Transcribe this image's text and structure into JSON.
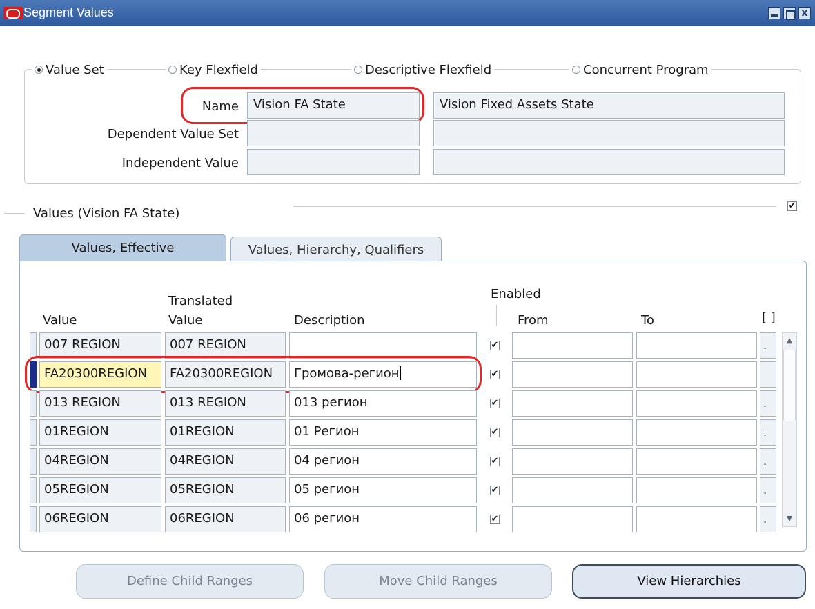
{
  "window": {
    "title": "Segment Values",
    "controls": {
      "minimize": "minimize",
      "maximize": "maximize",
      "close": "x"
    }
  },
  "query_by": {
    "options": [
      "Value Set",
      "Key Flexfield",
      "Descriptive Flexfield",
      "Concurrent Program"
    ],
    "selected": "Value Set",
    "name_label": "Name",
    "name_value": "Vision FA State",
    "name_description": "Vision Fixed Assets State",
    "dependent_label": "Dependent Value Set",
    "dependent_value": "",
    "dependent_description": "",
    "independent_label": "Independent Value",
    "independent_value": "",
    "independent_description": ""
  },
  "values_section": {
    "title": "Values (Vision FA State)",
    "checkbox_checked": true
  },
  "tabs": [
    {
      "label": "Values, Effective",
      "active": true
    },
    {
      "label": "Values, Hierarchy, Qualifiers",
      "active": false
    }
  ],
  "table": {
    "headers": {
      "value": "Value",
      "translated_line1": "Translated",
      "translated_line2": "Value",
      "description": "Description",
      "enabled": "Enabled",
      "from": "From",
      "to": "To",
      "dff": "[ ]"
    },
    "rows": [
      {
        "value": "007 REGION",
        "translated": "007 REGION",
        "description": "",
        "enabled": true,
        "from": "",
        "to": ""
      },
      {
        "value": "FA20300REGION",
        "translated": "FA20300REGION",
        "description": "Громова-регион",
        "enabled": true,
        "from": "",
        "to": ""
      },
      {
        "value": "013 REGION",
        "translated": "013 REGION",
        "description": "013 регион",
        "enabled": true,
        "from": "",
        "to": ""
      },
      {
        "value": "01REGION",
        "translated": "01REGION",
        "description": "01 Регион",
        "enabled": true,
        "from": "",
        "to": ""
      },
      {
        "value": "04REGION",
        "translated": "04REGION",
        "description": "04 регион",
        "enabled": true,
        "from": "",
        "to": ""
      },
      {
        "value": "05REGION",
        "translated": "05REGION",
        "description": "05 регион",
        "enabled": true,
        "from": "",
        "to": ""
      },
      {
        "value": "06REGION",
        "translated": "06REGION",
        "description": "06 регион",
        "enabled": true,
        "from": "",
        "to": ""
      }
    ],
    "current_row": 1
  },
  "buttons": {
    "define_child_ranges": "Define Child Ranges",
    "move_child_ranges": "Move Child Ranges",
    "view_hierarchies": "View Hierarchies"
  },
  "colors": {
    "titlebar": "#2e5a9e",
    "highlight": "#e02a2a",
    "current_cell": "#fff6b8",
    "tab_active": "#b9cde3"
  }
}
